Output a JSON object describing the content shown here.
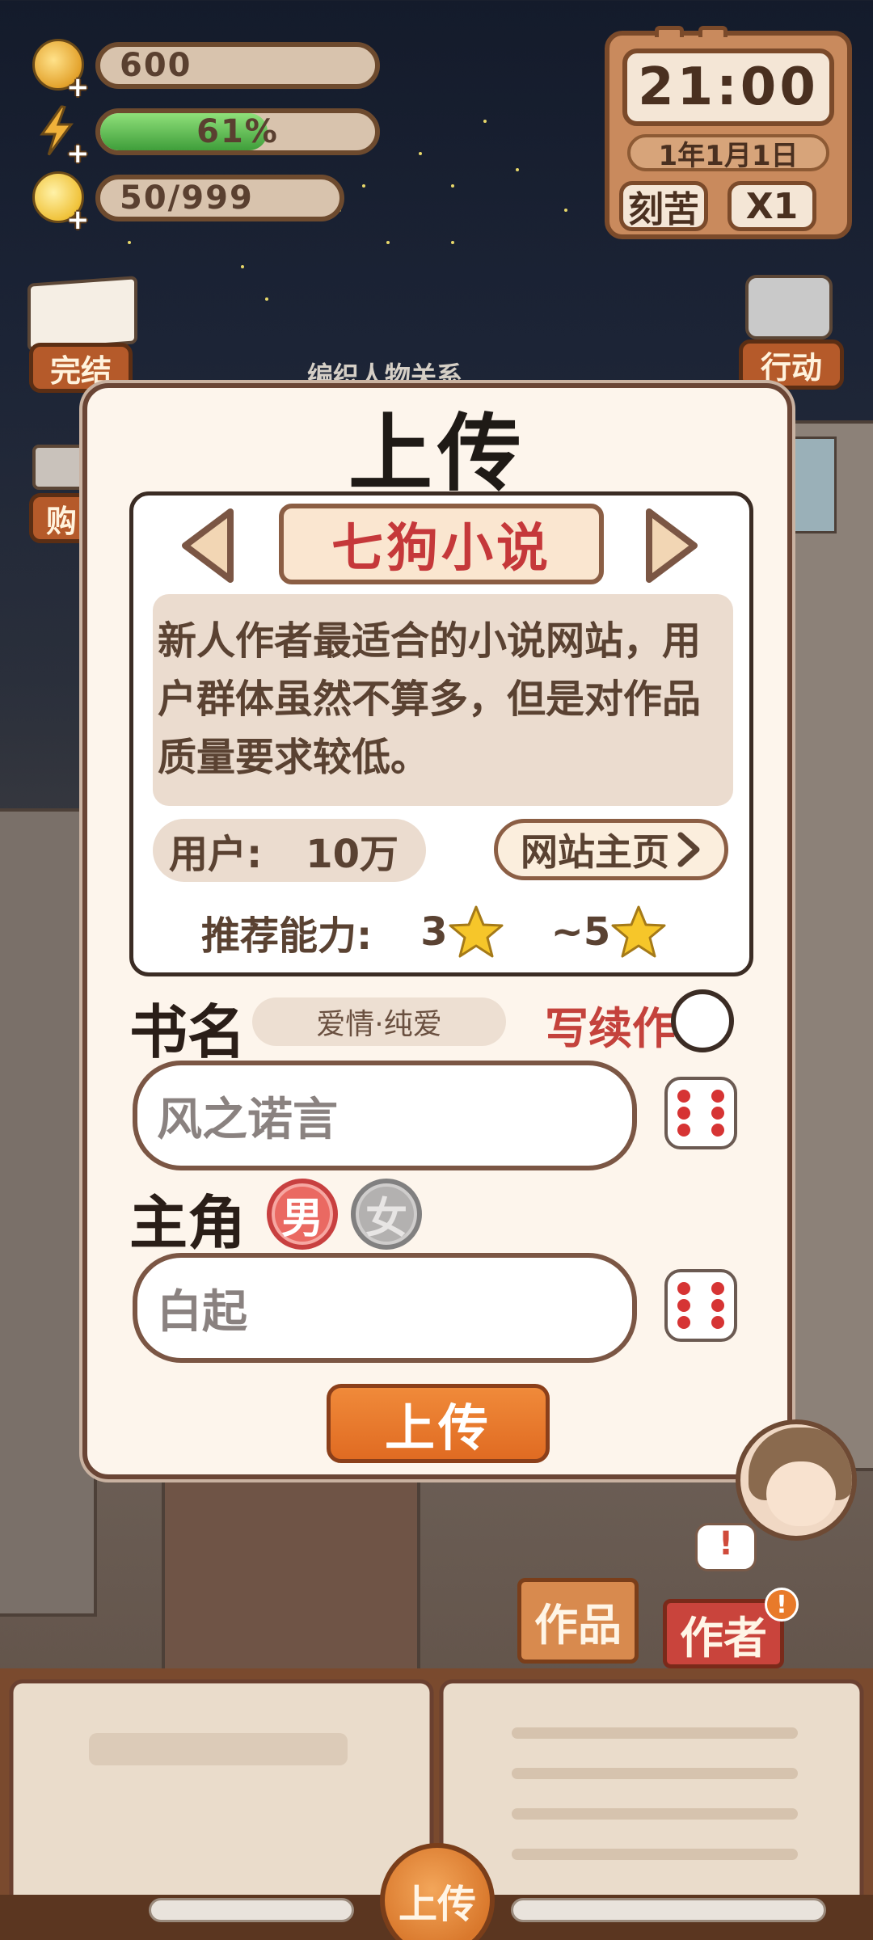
{
  "hud": {
    "coins": "600",
    "energy_label": "61%",
    "energy_value": 0.61,
    "inspiration": "50/999"
  },
  "clock": {
    "time": "21:00",
    "date": "1年1月1日",
    "mode_button": "刻苦",
    "speed_button": "X1"
  },
  "side_buttons": {
    "finished": "完结",
    "shop": "购",
    "action": "行动"
  },
  "behind_dialog_text": "编织人物关系",
  "dialog": {
    "title": "上传",
    "site": {
      "name": "七狗小说",
      "description": "新人作者最适合的小说网站，用户群体虽然不算多，但是对作品质量要求较低。",
      "users_label": "用户:",
      "users_value": "10万",
      "homepage_button": "网站主页",
      "recommend_label": "推荐能力:",
      "recommend_min": "3",
      "recommend_max": "~5"
    },
    "book_name_label": "书名",
    "genre": "爱情·纯爱",
    "sequel_label": "写续作",
    "book_name_value": "风之诺言",
    "protagonist_label": "主角",
    "gender_male": "男",
    "gender_female": "女",
    "protagonist_value": "白起",
    "upload_button": "上传"
  },
  "bottom": {
    "works_tab": "作品",
    "author_tab": "作者",
    "alert": "!",
    "upload_button": "上传"
  },
  "colors": {
    "accent_orange": "#e9772a",
    "title_red": "#c5383a",
    "energy_green": "#4caf50"
  }
}
